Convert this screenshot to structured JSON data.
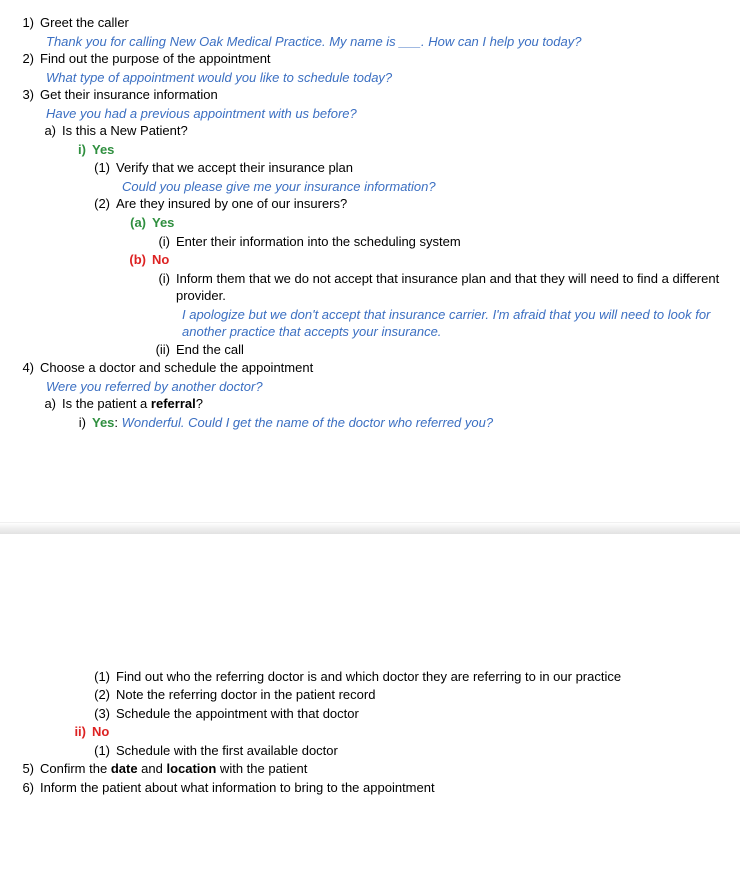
{
  "n1": "1)",
  "t1": "Greet the caller",
  "p1": "Thank you for calling New Oak Medical Practice. My name is ___. How can I help you today?",
  "n2": "2)",
  "t2": "Find out the purpose of the appointment",
  "p2": "What type of appointment would you like to schedule today?",
  "n3": "3)",
  "t3": "Get their insurance information",
  "p3": "Have you had a previous appointment with us before?",
  "n3a": "a)",
  "t3a": "Is this a New Patient?",
  "n3ai": "i)",
  "t3ai": "Yes",
  "n3ai1": "(1)",
  "t3ai1": "Verify that we accept their insurance plan",
  "p3ai1": "Could you please give me your insurance information?",
  "n3ai2": "(2)",
  "t3ai2": "Are they insured by one of our insurers?",
  "n3ai2a": "(a)",
  "t3ai2a": "Yes",
  "n3ai2ai": "(i)",
  "t3ai2ai": "Enter their information into the scheduling system",
  "n3ai2b": "(b)",
  "t3ai2b": "No",
  "n3ai2bi": "(i)",
  "t3ai2bi": "Inform them that we do not accept that insurance plan and that they will need to find a different provider.",
  "p3ai2bi": "I apologize but we don't accept that insurance carrier. I'm afraid that you will need to look for another practice that accepts your insurance.",
  "n3ai2bii": "(ii)",
  "t3ai2bii": "End the call",
  "n4": "4)",
  "t4": "Choose a doctor and schedule the appointment",
  "p4": "Were you referred by another doctor?",
  "n4a": "a)",
  "t4a_pre": "Is the patient a ",
  "t4a_b": "referral",
  "t4a_post": "?",
  "n4ai": "i)",
  "t4ai_yes": "Yes",
  "t4ai_colon": ": ",
  "t4ai_prompt": "Wonderful. Could I get the name of the doctor who referred you?",
  "n4ai1": "(1)",
  "t4ai1": "Find out who the referring doctor is and which doctor they are referring to in our practice",
  "n4ai2": "(2)",
  "t4ai2": "Note the referring doctor in the patient record",
  "n4ai3": "(3)",
  "t4ai3": "Schedule the appointment with that doctor",
  "n4aii": "ii)",
  "t4aii": "No",
  "n4aii1": "(1)",
  "t4aii1": "Schedule with the first available doctor",
  "n5": "5)",
  "t5_pre": "Confirm the ",
  "t5_b1": "date",
  "t5_mid": " and ",
  "t5_b2": "location",
  "t5_post": " with the patient",
  "n6": "6)",
  "t6": "Inform the patient about what information to bring to the appointment"
}
